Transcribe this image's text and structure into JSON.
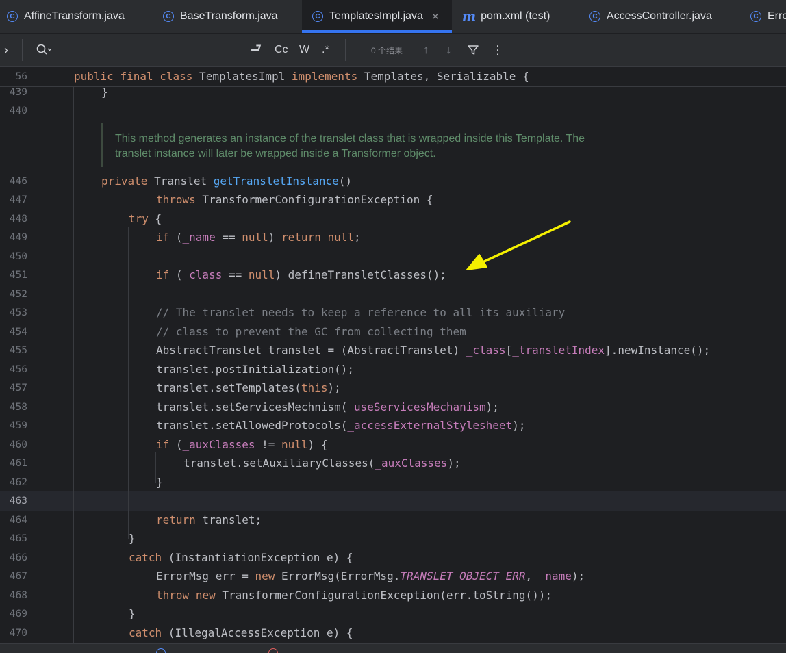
{
  "tabs": [
    {
      "label": "AffineTransform.java",
      "icon": "class-icon",
      "active": false
    },
    {
      "label": "BaseTransform.java",
      "icon": "class-icon",
      "active": false
    },
    {
      "label": "TemplatesImpl.java",
      "icon": "class-icon",
      "active": true
    },
    {
      "label": "pom.xml (test)",
      "icon": "maven-icon",
      "active": false
    },
    {
      "label": "AccessController.java",
      "icon": "class-icon",
      "active": false
    },
    {
      "label": "Erro",
      "icon": "class-icon",
      "active": false
    }
  ],
  "findbar": {
    "expand_icon": "›",
    "search_icon": "search-icon",
    "wrap_label": "⮐",
    "match_case": "Cc",
    "words": "W",
    "regex": ".*",
    "results": "0 个结果",
    "prev": "↑",
    "next": "↓",
    "filter": "⏷",
    "more": "⋮"
  },
  "sticky": {
    "line": "56",
    "code": "public final class TemplatesImpl implements Templates, Serializable {"
  },
  "doc_comment": {
    "line1": "This method generates an instance of the translet class that is wrapped inside this Template. The",
    "line2": "translet instance will later be wrapped inside a Transformer object."
  },
  "lines": {
    "l439": "439",
    "l440": "440",
    "l446": "446",
    "l447": "447",
    "l448": "448",
    "l449": "449",
    "l450": "450",
    "l451": "451",
    "l452": "452",
    "l453": "453",
    "l454": "454",
    "l455": "455",
    "l456": "456",
    "l457": "457",
    "l458": "458",
    "l459": "459",
    "l460": "460",
    "l461": "461",
    "l462": "462",
    "l463": "463",
    "l464": "464",
    "l465": "465",
    "l466": "466",
    "l467": "467",
    "l468": "468",
    "l469": "469",
    "l470": "470"
  },
  "code": {
    "kw_public": "public",
    "kw_final": "final",
    "kw_class": "class",
    "cls_name": " TemplatesImpl ",
    "kw_implements": "implements",
    "ifaces": " Templates, Serializable {",
    "c439": "}",
    "c446_kw": "private",
    "c446_t": " Translet ",
    "c446_fn": "getTransletInstance",
    "c446_e": "()",
    "c447_kw": "throws",
    "c447_t": " TransformerConfigurationException {",
    "c448_kw": "try",
    "c448_t": " {",
    "c449_kw1": "if",
    "c449_a": " (",
    "c449_f": "_name",
    "c449_b": " == ",
    "c449_kw2": "null",
    "c449_c": ") ",
    "c449_kw3": "return",
    "c449_d": " ",
    "c449_kw4": "null",
    "c449_e": ";",
    "c451_kw1": "if",
    "c451_a": " (",
    "c451_f": "_class",
    "c451_b": " == ",
    "c451_kw2": "null",
    "c451_c": ") defineTransletClasses();",
    "c453": "// The translet needs to keep a reference to all its auxiliary",
    "c454": "// class to prevent the GC from collecting them",
    "c455_a": "AbstractTranslet translet = (AbstractTranslet) ",
    "c455_f1": "_class",
    "c455_b": "[",
    "c455_f2": "_transletIndex",
    "c455_c": "].newInstance();",
    "c456": "translet.postInitialization();",
    "c457_a": "translet.setTemplates(",
    "c457_kw": "this",
    "c457_b": ");",
    "c458_a": "translet.setServicesMechnism(",
    "c458_f": "_useServicesMechanism",
    "c458_b": ");",
    "c459_a": "translet.setAllowedProtocols(",
    "c459_f": "_accessExternalStylesheet",
    "c459_b": ");",
    "c460_kw1": "if",
    "c460_a": " (",
    "c460_f": "_auxClasses",
    "c460_b": " != ",
    "c460_kw2": "null",
    "c460_c": ") {",
    "c461_a": "translet.setAuxiliaryClasses(",
    "c461_f": "_auxClasses",
    "c461_b": ");",
    "c462": "}",
    "c464_kw": "return",
    "c464_t": " translet;",
    "c465": "}",
    "c466_kw": "catch",
    "c466_t": " (InstantiationException e) {",
    "c467_a": "ErrorMsg err = ",
    "c467_kw": "new",
    "c467_b": " ErrorMsg(ErrorMsg.",
    "c467_c": "TRANSLET_OBJECT_ERR",
    "c467_d": ", ",
    "c467_f": "_name",
    "c467_e": ");",
    "c468_kw1": "throw",
    "c468_a": " ",
    "c468_kw2": "new",
    "c468_b": " TransformerConfigurationException(err.toString());",
    "c469": "}",
    "c470_kw": "catch",
    "c470_t": " (IllegalAccessException e) {"
  },
  "colors": {
    "keyword": "#cf8e6d",
    "method": "#56a8f5",
    "field": "#c77dbb",
    "comment": "#7a7e85",
    "doc": "#5f8c6a",
    "accent": "#3574f0",
    "arrow": "#f5f000"
  }
}
